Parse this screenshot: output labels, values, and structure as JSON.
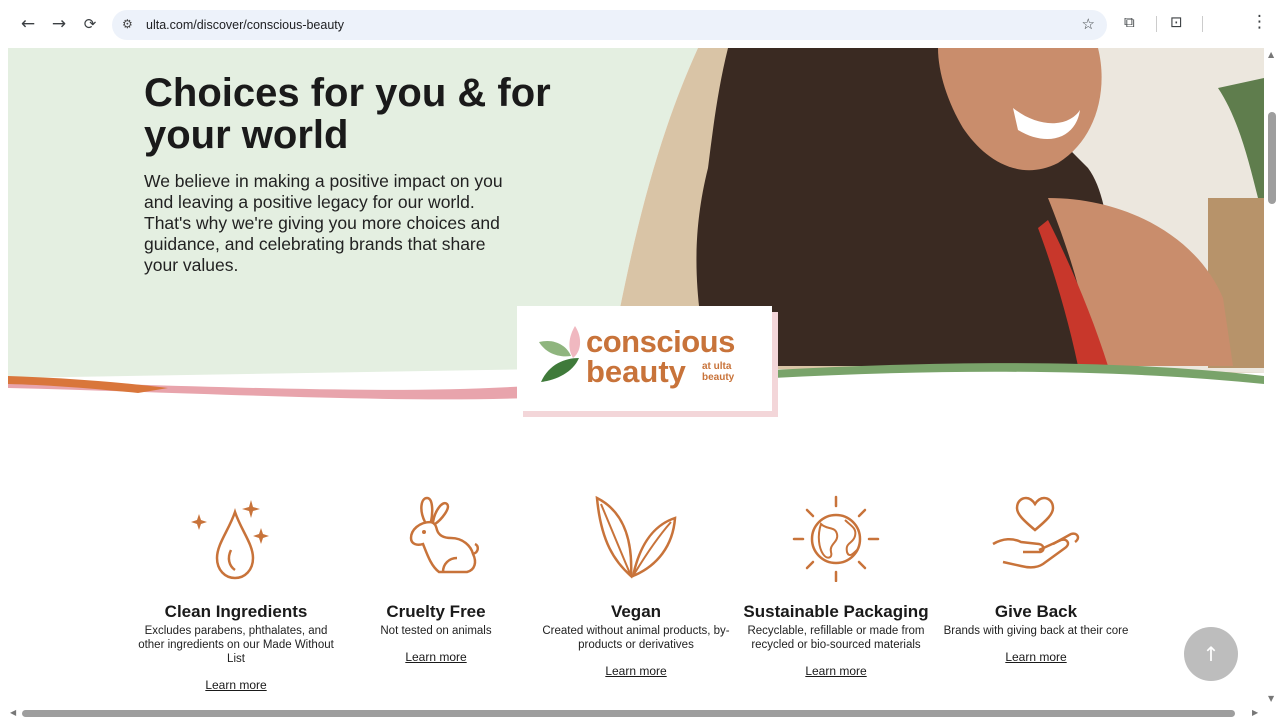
{
  "browser": {
    "url": "ulta.com/discover/conscious-beauty",
    "back_icon": "←",
    "forward_icon": "→",
    "reload_icon": "⟳",
    "site_info_icon": "⚙",
    "bookmark_icon": "☆",
    "extensions_icon": "⧉",
    "lens_icon": "⊡",
    "menu_icon": "⋮"
  },
  "hero": {
    "headline": "Choices for you & for your world",
    "intro": "We believe in making a positive impact on you and leaving a positive legacy for our world. That's why we're giving you more choices and guidance, and celebrating brands that share your values.",
    "badge": {
      "word1": "conscious",
      "word2": "beauty",
      "sub": "at ulta beauty"
    }
  },
  "features": [
    {
      "title": "Clean Ingredients",
      "desc": "Excludes parabens, phthalates, and other ingredients on our Made Without List",
      "link": "Learn more"
    },
    {
      "title": "Cruelty Free",
      "desc": "Not tested on animals",
      "link": "Learn more"
    },
    {
      "title": "Vegan",
      "desc": "Created without animal products, by-products or derivatives",
      "link": "Learn more"
    },
    {
      "title": "Sustainable Packaging",
      "desc": "Recyclable, refillable or made from recycled or bio-sourced materials",
      "link": "Learn more"
    },
    {
      "title": "Give Back",
      "desc": "Brands with giving back at their core",
      "link": "Learn more"
    }
  ],
  "scroll_top_icon": "↑",
  "colors": {
    "accent_orange": "#c8733a",
    "hero_green": "#e4efe1",
    "stripe_pink": "#e8a4ac",
    "stripe_green": "#79a36a"
  }
}
